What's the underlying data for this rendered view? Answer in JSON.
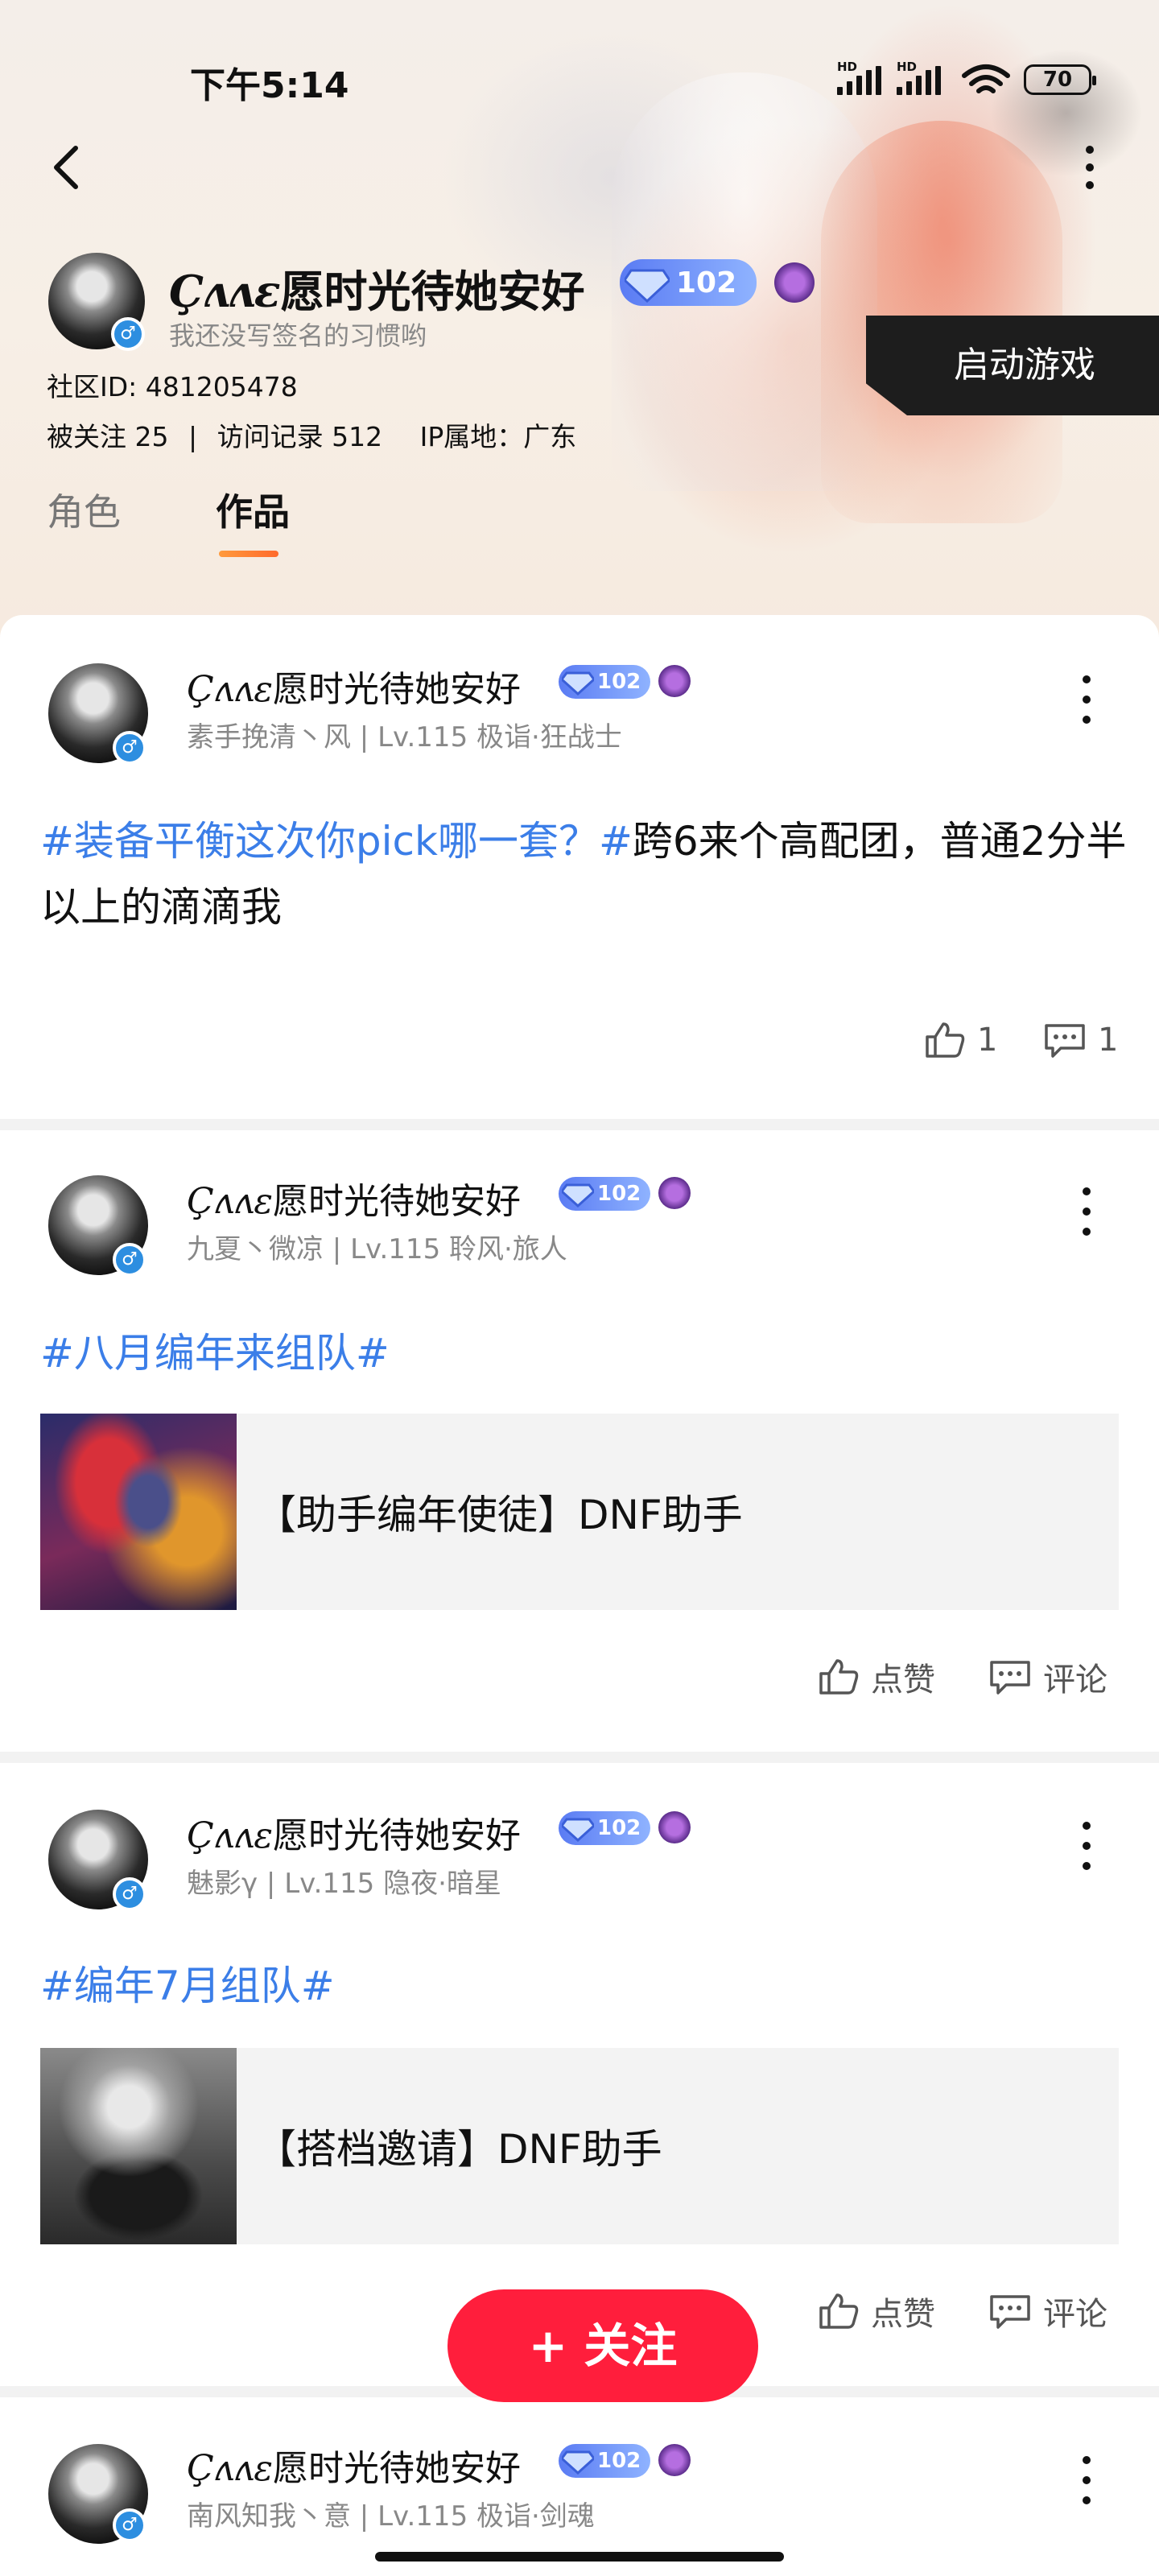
{
  "status_bar": {
    "time": "下午5:14",
    "battery": "70",
    "hd_label": "HD"
  },
  "profile": {
    "name_deco": "Çʌʌɛ",
    "name": "愿时光待她安好",
    "level_badge": "102",
    "signature": "我还没写签名的习惯哟",
    "community_id": "社区ID: 481205478",
    "followers": "被关注 25",
    "visits": "访问记录  512",
    "ip": "IP属地：广东",
    "separator": "|",
    "gender_symbol": "♂",
    "launch_button": "启动游戏"
  },
  "tabs": [
    {
      "label": "角色",
      "active": false
    },
    {
      "label": "作品",
      "active": true
    }
  ],
  "posts": [
    {
      "author_deco": "Çʌʌɛ",
      "author": "愿时光待她安好",
      "badge": "102",
      "meta": "素手挽清丶风 | Lv.115 极诣·狂战士",
      "tag1": "#装备平衡这次你pick哪一套？#",
      "text": "跨6来个高配团，普通2分半以上的滴滴我",
      "likes": "1",
      "comments": "1"
    },
    {
      "author_deco": "Çʌʌɛ",
      "author": "愿时光待她安好",
      "badge": "102",
      "meta": "九夏丶微凉 | Lv.115 聆风·旅人",
      "tag1": "#八月编年来组队#",
      "card_title": "【助手编年使徒】DNF助手",
      "like_label": "点赞",
      "comment_label": "评论"
    },
    {
      "author_deco": "Çʌʌɛ",
      "author": "愿时光待她安好",
      "badge": "102",
      "meta": "魅影γ    | Lv.115 隐夜·暗星",
      "tag1": "#编年7月组队#",
      "card_title": "【搭档邀请】DNF助手",
      "like_label": "点赞",
      "comment_label": "评论"
    },
    {
      "author_deco": "Çʌʌɛ",
      "author": "愿时光待她安好",
      "badge": "102",
      "meta": "南风知我丶意 | Lv.115 极诣·剑魂"
    }
  ],
  "follow_button": "+ 关注",
  "colors": {
    "accent": "#3b7ee8",
    "follow": "#ff1e3c",
    "gender": "#2d8ee0",
    "tab_underline": "#ff7a2c"
  }
}
